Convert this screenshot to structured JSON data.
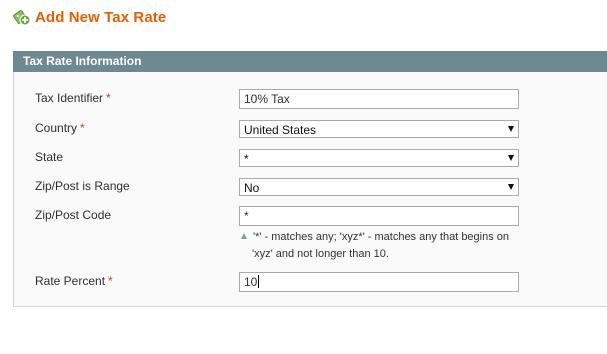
{
  "page": {
    "title": "Add New Tax Rate",
    "icon": "tax-rate-add-icon"
  },
  "fieldset": {
    "legend": "Tax Rate Information"
  },
  "fields": {
    "tax_identifier": {
      "label": "Tax Identifier",
      "required": "*",
      "value": "10% Tax"
    },
    "country": {
      "label": "Country",
      "required": "*",
      "value": "United States"
    },
    "state": {
      "label": "State",
      "value": "*"
    },
    "zip_is_range": {
      "label": "Zip/Post is Range",
      "value": "No"
    },
    "zip_code": {
      "label": "Zip/Post Code",
      "value": "*",
      "note_line1": "'*' - matches any; 'xyz*' - matches any that begins on",
      "note_line2": "'xyz' and not longer than 10."
    },
    "rate_percent": {
      "label": "Rate Percent",
      "required": "*",
      "value": "10"
    }
  },
  "colors": {
    "title": "#eb5e00",
    "legend_bar": "#6f8992",
    "required": "#eb340a"
  }
}
